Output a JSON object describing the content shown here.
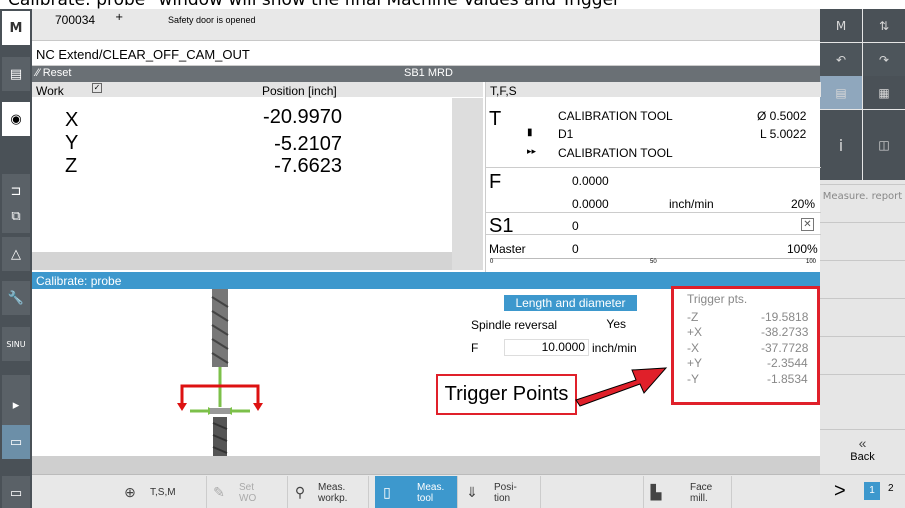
{
  "caption": "Calibrate: probe\" window will show the final Machine Values and Trigger",
  "header": {
    "machine_no": "700034",
    "arrow": "+",
    "message": "Safety door is opened"
  },
  "program": {
    "path": "NC Extend/CLEAR_OFF_CAM_OUT"
  },
  "status": {
    "reset": "Reset",
    "channel": "SB1 MRD"
  },
  "positions": {
    "work_label": "Work",
    "position_header": "Position [inch]",
    "rows": [
      {
        "axis": "X",
        "value": "-20.9970"
      },
      {
        "axis": "Y",
        "value": "-5.2107"
      },
      {
        "axis": "Z",
        "value": "-7.6623"
      }
    ]
  },
  "tfs": {
    "header": "T,F,S",
    "t_label": "T",
    "tool_name": "CALIBRATION TOOL",
    "diameter": "Ø 0.5002",
    "d_label": "D1",
    "length": "L 5.0022",
    "next_tool": "CALIBRATION TOOL",
    "f_label": "F",
    "f_value1": "0.0000",
    "f_value2": "0.0000",
    "f_unit": "inch/min",
    "f_override": "20%",
    "s_label": "S1",
    "s_value": "0",
    "master_label": "Master",
    "master_value": "0",
    "master_pct": "100%",
    "scale_0": "0",
    "scale_50": "50",
    "scale_100": "100"
  },
  "calibrate": {
    "title": "Calibrate: probe",
    "mode_button": "Length and diameter",
    "spindle_label": "Spindle reversal",
    "spindle_value": "Yes",
    "f_label": "F",
    "f_value": "10.0000",
    "f_unit": "inch/min"
  },
  "trigger": {
    "title": "Trigger pts.",
    "rows": [
      {
        "axis": "-Z",
        "value": "-19.5818"
      },
      {
        "axis": "+X",
        "value": "-38.2733"
      },
      {
        "axis": "-X",
        "value": "-37.7728"
      },
      {
        "axis": "+Y",
        "value": "-2.3544"
      },
      {
        "axis": "-Y",
        "value": "-1.8534"
      }
    ]
  },
  "annotation": {
    "label": "Trigger Points"
  },
  "right_sidebar": {
    "measure_report": "Measure. report",
    "back": "Back",
    "back_icon": "double-chevron-left-icon",
    "next": ">",
    "page1": "1",
    "page2": "2"
  },
  "softkeys": [
    {
      "label": "T,S,M",
      "icon": "tsm-icon"
    },
    {
      "label": "Set WO",
      "icon": "set-wo-icon"
    },
    {
      "label": "Meas. workp.",
      "icon": "measure-workpiece-icon"
    },
    {
      "label": "Meas. tool",
      "icon": "measure-tool-icon"
    },
    {
      "label": "Posi- tion",
      "icon": "position-icon"
    },
    {
      "label": "Face mill.",
      "icon": "face-mill-icon"
    }
  ],
  "colors": {
    "accent_blue": "#3d98cd",
    "annotation_red": "#e0202a",
    "sidebar_dark": "#4a5157"
  }
}
